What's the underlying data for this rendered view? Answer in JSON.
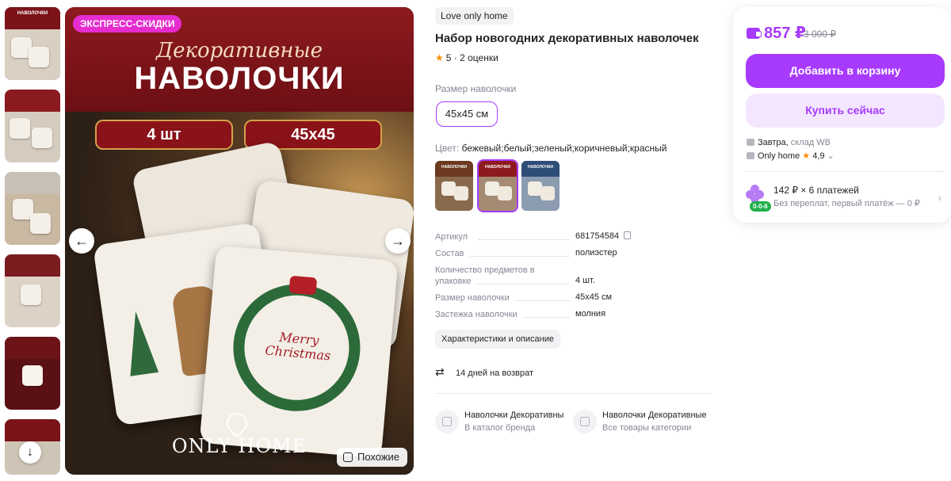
{
  "gallery": {
    "express_badge": "ЭКСПРЕСС-СКИДКИ",
    "photo_script": "Декоративные",
    "photo_title": "НАВОЛОЧКИ",
    "photo_count_badge": "4 шт",
    "photo_size_badge": "45x45",
    "photo_wreath_text": "Merry\nChristmas",
    "photo_logo": "ONLY HOME",
    "similar_label": "Похожие",
    "prev_icon": "arrow-left-icon",
    "next_icon": "arrow-right-icon",
    "thumbnails": [
      {
        "caption": "НАВОЛОЧКИ",
        "top": "#7b1318",
        "body": "#d9cfc2"
      },
      {
        "caption": "",
        "top": "#8a1a1e",
        "body": "#d5cbbf"
      },
      {
        "caption": "",
        "top": "#c8c0b4",
        "body": "#c9b8a2"
      },
      {
        "caption": "",
        "top": "#7a1c20",
        "body": "#dcd3c6"
      },
      {
        "caption": "",
        "top": "#6d1419",
        "body": "#5a1014"
      },
      {
        "caption": "",
        "top": "#7a1419",
        "body": "#cfc5b7"
      }
    ]
  },
  "product": {
    "brand": "Love only home",
    "title": "Набор новогодних декоративных наволочек",
    "rating_value": "5",
    "rating_count": "· 2 оценки",
    "size_label": "Размер наволочки",
    "size_selected": "45x45 см",
    "color_label": "Цвет:",
    "color_value": "бежевый;белый;зеленый;коричневый;красный",
    "swatches": [
      {
        "caption": "НАВОЛОЧКИ",
        "top": "#6b3a1f",
        "body": "#8a6a4d",
        "selected": false
      },
      {
        "caption": "НАВОЛОЧКИ",
        "top": "#8e1a1f",
        "body": "#a58b73",
        "selected": true
      },
      {
        "caption": "НАВОЛОЧКИ",
        "top": "#2e4e78",
        "body": "#8b9bb0",
        "selected": false
      }
    ],
    "specs": [
      {
        "key": "Артикул",
        "value": "681754584"
      },
      {
        "key": "Состав",
        "value": "полиэстер"
      },
      {
        "key": "Количество предметов в упаковке",
        "value": "4 шт."
      },
      {
        "key": "Размер наволочки",
        "value": "45x45 см"
      },
      {
        "key": "Застежка наволочки",
        "value": "молния"
      }
    ],
    "characteristics_button": "Характеристики и описание",
    "return_text": "14 дней на возврат",
    "links": [
      {
        "title": "Наволочки Декоративные",
        "subtitle": "В каталог бренда"
      },
      {
        "title": "Наволочки Декоративные",
        "subtitle": "Все товары категории"
      }
    ]
  },
  "buy": {
    "price": "857 ₽",
    "old_price": "3 000 ₽",
    "add_to_cart": "Добавить в корзину",
    "buy_now": "Купить сейчас",
    "delivery_day": "Завтра,",
    "delivery_wh": "склад WB",
    "seller": "Only home",
    "seller_rating": "4,9",
    "installment_title": "142 ₽ × 6 платежей",
    "installment_sub": "Без переплат, первый платёж — 0 ₽",
    "installment_badge": "0-0-6",
    "accent": "#a73afd"
  }
}
